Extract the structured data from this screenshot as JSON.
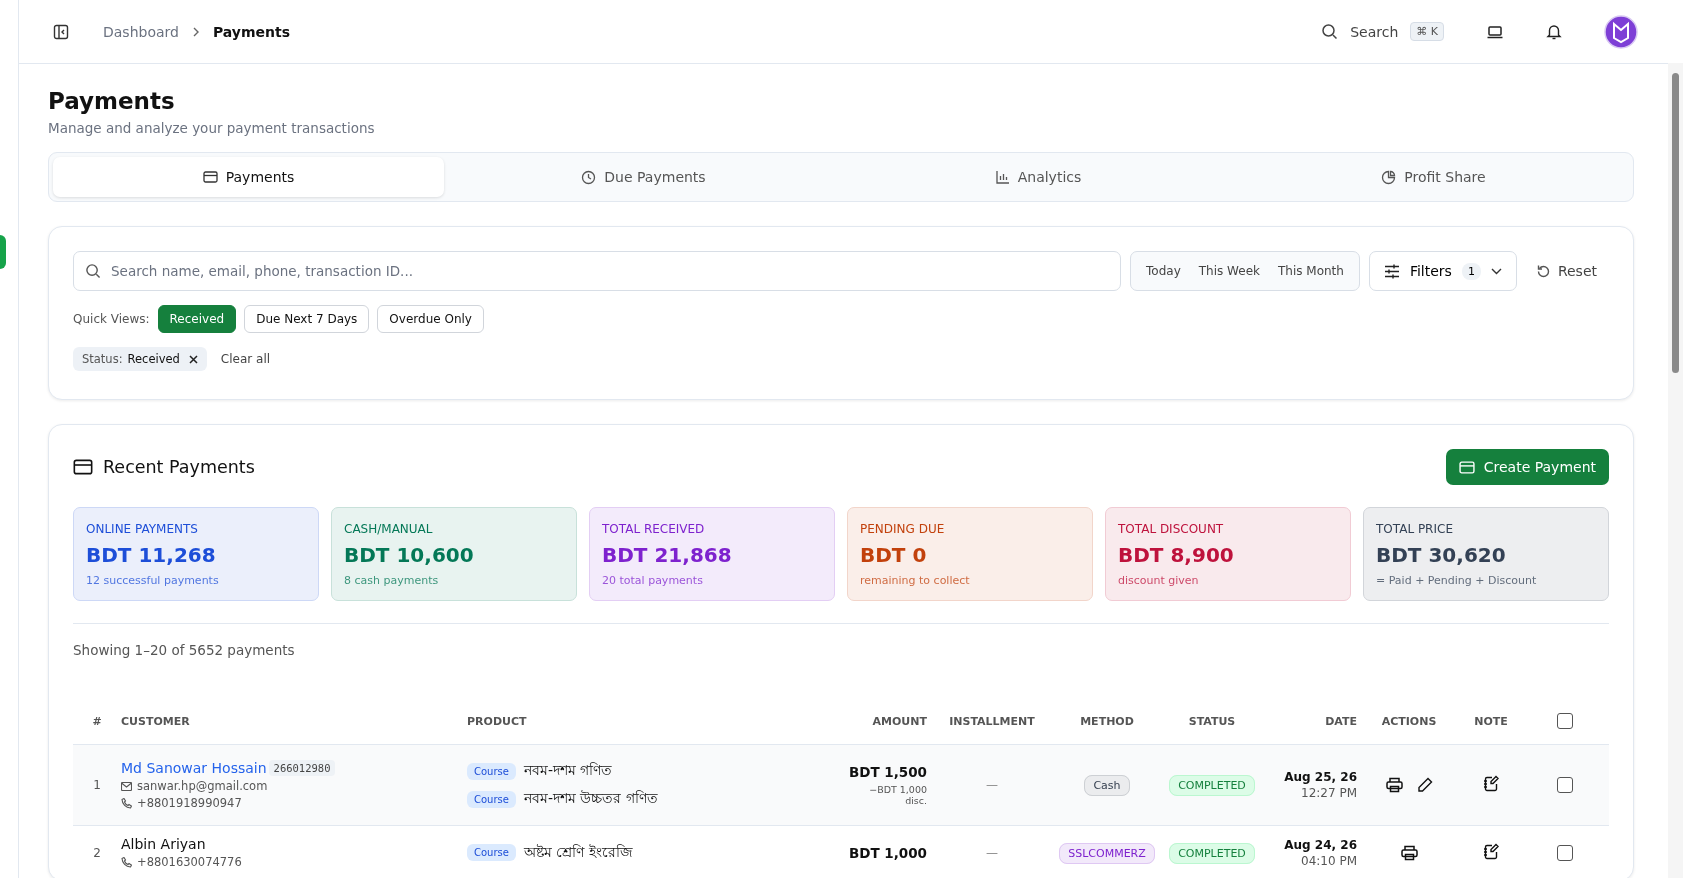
{
  "breadcrumb": [
    "Dashboard",
    "Payments"
  ],
  "header": {
    "search_label": "Search",
    "shortcut": "⌘ K"
  },
  "page": {
    "title": "Payments",
    "subtitle": "Manage and analyze your payment transactions"
  },
  "tabs": [
    {
      "label": "Payments",
      "selected": true
    },
    {
      "label": "Due Payments",
      "selected": false
    },
    {
      "label": "Analytics",
      "selected": false
    },
    {
      "label": "Profit Share",
      "selected": false
    }
  ],
  "filters": {
    "search_placeholder": "Search name, email, phone, transaction ID...",
    "ranges": [
      {
        "label": "Today",
        "selected": false
      },
      {
        "label": "This Week",
        "selected": false
      },
      {
        "label": "This Month",
        "selected": false
      }
    ],
    "filters_label": "Filters",
    "filters_count": "1",
    "reset_label": "Reset",
    "quick_views_label": "Quick Views:",
    "quick_views": [
      {
        "label": "Received",
        "selected": true
      },
      {
        "label": "Due Next 7 Days",
        "selected": false
      },
      {
        "label": "Overdue Only",
        "selected": false
      }
    ],
    "active_filters": [
      {
        "key": "Status:",
        "value": "Received"
      }
    ],
    "clear_all": "Clear all"
  },
  "recent": {
    "title": "Recent Payments",
    "create_button": "Create Payment",
    "stats": [
      {
        "label": "ONLINE PAYMENTS",
        "value": "BDT 11,268",
        "note": "12 successful payments",
        "color": "#1d4ed8"
      },
      {
        "label": "CASH/MANUAL",
        "value": "BDT 10,600",
        "note": "8 cash payments",
        "color": "#047857"
      },
      {
        "label": "TOTAL RECEIVED",
        "value": "BDT 21,868",
        "note": "20 total payments",
        "color": "#7e22ce"
      },
      {
        "label": "PENDING DUE",
        "value": "BDT 0",
        "note": "remaining to collect",
        "color": "#c2410c"
      },
      {
        "label": "TOTAL DISCOUNT",
        "value": "BDT 8,900",
        "note": "discount given",
        "color": "#be123c"
      },
      {
        "label": "TOTAL PRICE",
        "value": "BDT 30,620",
        "note": "= Paid + Pending + Discount",
        "color": "#334155"
      }
    ],
    "showing": "Showing 1–20 of 5652 payments",
    "table": {
      "columns": [
        "#",
        "CUSTOMER",
        "PRODUCT",
        "AMOUNT",
        "INSTALLMENT",
        "METHOD",
        "STATUS",
        "DATE",
        "ACTIONS",
        "NOTE"
      ],
      "select_all_checked": false,
      "rows": [
        {
          "index": "1",
          "name": "Md Sanowar Hossain",
          "linked": true,
          "id_badge": "266012980",
          "email": "sanwar.hp@gmail.com",
          "phone": "+8801918990947",
          "products": [
            {
              "tag": "Course",
              "name": "নবম-দশম গণিত"
            },
            {
              "tag": "Course",
              "name": "নবম-দশম উচ্চতর গণিত"
            }
          ],
          "amount": "BDT 1,500",
          "discount": "−BDT 1,000 disc.",
          "installment": "—",
          "method": {
            "label": "Cash",
            "color": "#374151"
          },
          "status": "COMPLETED",
          "date": "Aug 25, 26",
          "time": "12:27 PM",
          "editable": true,
          "checked": false
        },
        {
          "index": "2",
          "name": "Albin Ariyan",
          "linked": false,
          "phone": "+8801630074776",
          "products": [
            {
              "tag": "Course",
              "name": "অষ্টম শ্রেণি ইংরেজি"
            }
          ],
          "amount": "BDT 1,000",
          "installment": "—",
          "method": {
            "label": "SSLCOMMERZ",
            "color": "#7e22ce"
          },
          "status": "COMPLETED",
          "date": "Aug 24, 26",
          "time": "04:10 PM",
          "editable": false,
          "checked": false
        }
      ]
    }
  }
}
